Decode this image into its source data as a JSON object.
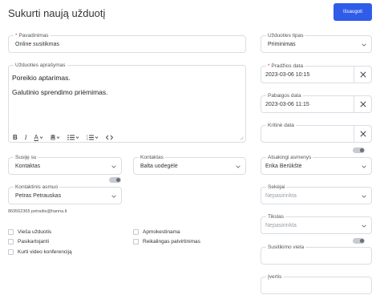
{
  "header": {
    "title": "Sukurti naują užduotį",
    "save_label": "Išsaugoti"
  },
  "form": {
    "name": {
      "label": "Pavadinimas",
      "value": "Online susitikmas"
    },
    "description": {
      "label": "Užduoties aprašymas",
      "lines": [
        "Poreikio aptarimas.",
        "Galutinio sprendimo priėmimas."
      ],
      "toolbar": [
        "bold-icon",
        "italic-icon",
        "text-color-icon",
        "highlight-color-icon",
        "bullet-list-icon",
        "numbered-list-icon",
        "code-icon"
      ]
    },
    "related_to": {
      "label": "Susiję su",
      "value": "Kontaktas"
    },
    "contact": {
      "label": "Kontaktas",
      "value": "Balta uodegėlė"
    },
    "contact_person": {
      "label": "Kontaktinis asmuo",
      "value": "Petras Petrauskas"
    },
    "contact_info": "869562365 petraitis@hanna.lt",
    "checkboxes": {
      "public_task": "Vieša užduotis",
      "repeating": "Pasikartojanti",
      "video_conference": "Kurti video konferenciją",
      "billable": "Apmokestinama",
      "needs_confirmation": "Reikalingas patvirtinimas"
    },
    "task_type": {
      "label": "Užduoties tipas",
      "value": "Priminimas"
    },
    "start_date": {
      "label": "Pradžios data",
      "value": "2023-03-06 10:15"
    },
    "end_date": {
      "label": "Pabaigos data",
      "value": "2023-03-06 11:15"
    },
    "critical_date": {
      "label": "Kritinė data",
      "value": ""
    },
    "responsible": {
      "label": "Atsakingi asmenys",
      "value": "Erika Berūkštė"
    },
    "followers": {
      "label": "Sekėjai",
      "placeholder": "Nepasirinkta"
    },
    "goal": {
      "label": "Tikslas",
      "placeholder": "Nepasirinkta"
    },
    "meeting_place": {
      "label": "Susitikimo vieta",
      "value": ""
    },
    "rating": {
      "label": "Įvertis",
      "value": ""
    }
  },
  "colors": {
    "primary": "#2f5ce8",
    "required": "#e23b3b",
    "border": "#d9dde3"
  }
}
